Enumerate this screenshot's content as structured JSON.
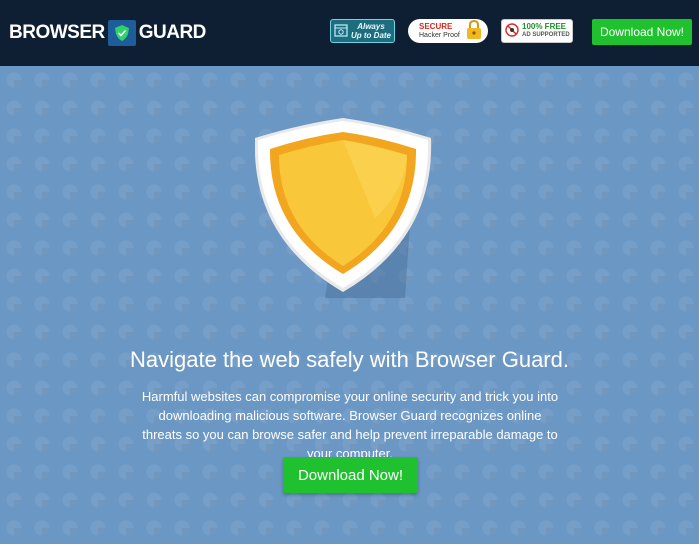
{
  "header": {
    "logo_left": "BROWSER",
    "logo_right": "GUARD",
    "logo_icon": "shield-check-icon",
    "badges": {
      "uptodate_line1": "Always",
      "uptodate_line2": "Up to Date",
      "secure_title": "SECURE",
      "secure_sub": "Hacker Proof",
      "free_title": "100% FREE",
      "free_sub": "AD SUPPORTED"
    },
    "download_label": "Download Now!"
  },
  "hero": {
    "headline": "Navigate the web safely with Browser Guard.",
    "description": "Harmful websites can compromise your online security and trick you into downloading malicious software. Browser Guard recognizes online threats so you can browse safer and help prevent irreparable damage to your computer.",
    "download_label": "Download Now!"
  },
  "colors": {
    "header_bg": "#0e1f33",
    "hero_bg": "#6b97c4",
    "button_green": "#1fc22e",
    "shield_gold": "#f5b82e"
  }
}
